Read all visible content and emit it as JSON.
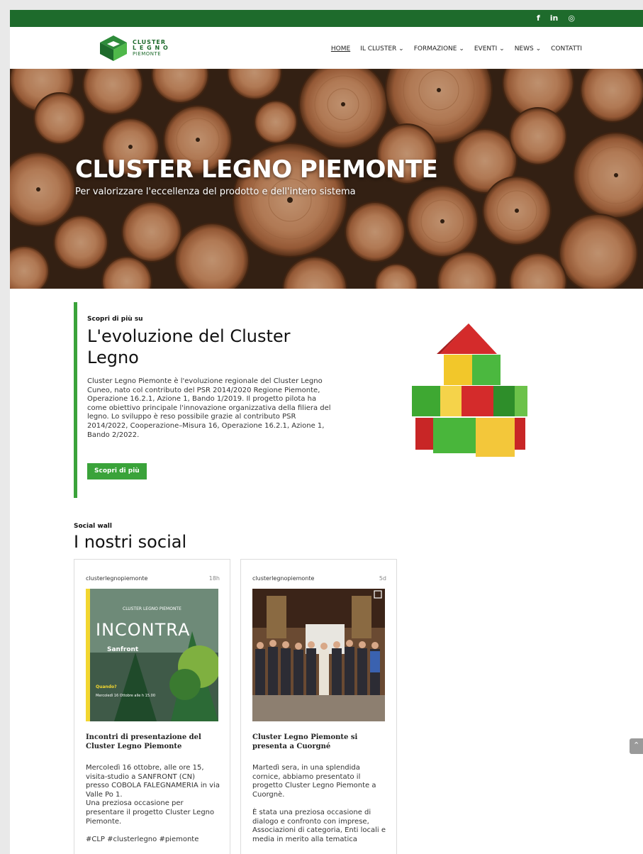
{
  "social": {
    "facebook": "f",
    "linkedin": "in",
    "instagram": "◎"
  },
  "logo": {
    "line1": "CLUSTER",
    "line2": "L E G N O",
    "line3": "PIEMONTE"
  },
  "nav": [
    {
      "label": "HOME"
    },
    {
      "label": "IL CLUSTER ⌄"
    },
    {
      "label": "FORMAZIONE ⌄"
    },
    {
      "label": "EVENTI ⌄"
    },
    {
      "label": "NEWS ⌄"
    },
    {
      "label": "CONTATTI"
    }
  ],
  "hero": {
    "title": "CLUSTER LEGNO PIEMONTE",
    "subtitle": "Per valorizzare l'eccellenza del prodotto e dell'intero sistema"
  },
  "about": {
    "kicker": "Scopri di più su",
    "title": "L'evoluzione del Cluster Legno",
    "body": "Cluster Legno Piemonte è l'evoluzione regionale del Cluster Legno Cuneo, nato col contributo del PSR 2014/2020 Regione Piemonte, Operazione 16.2.1, Azione 1, Bando 1/2019. Il progetto pilota ha come obiettivo principale l'innovazione organizzativa della filiera del legno. Lo sviluppo è reso possibile grazie al contributo PSR 2014/2022, Cooperazione–Misura 16, Operazione 16.2.1, Azione 1, Bando 2/2022.",
    "button": "Scopri di più"
  },
  "social_wall": {
    "kicker": "Social wall",
    "title": "I nostri social",
    "posts": [
      {
        "user": "clusterlegnopiemonte",
        "time": "18h",
        "image_text": {
          "brand": "CLUSTER LEGNO PIEMONTE",
          "headline": "INCONTRA",
          "place": "Sanfront",
          "when_label": "Quando?",
          "when_value": "Mercoledì 16 Ottobre alle h 15.00"
        },
        "title": "Incontri di presentazione del Cluster Legno Piemonte",
        "body": "Mercoledì 16 ottobre, alle ore 15, visita-studio a SANFRONT (CN) presso COBOLA FALEGNAMERIA in via Valle Po 1.\nUna preziosa occasione per presentare il progetto Cluster Legno Piemonte.\n\n#CLP #clusterlegno #piemonte"
      },
      {
        "user": "clusterlegnopiemonte",
        "time": "5d",
        "title": "Cluster Legno Piemonte si presenta a Cuorgné",
        "body": "Martedì sera, in una splendida cornice, abbiamo presentato il progetto Cluster Legno Piemonte a Cuorgnè.\n\nÈ stata una preziosa occasione di dialogo e confronto con imprese, Associazioni di categoria, Enti locali e media in merito alla tematica"
      }
    ]
  },
  "colors": {
    "brand_green": "#1e6b2c",
    "accent_green": "#3aa33a"
  }
}
